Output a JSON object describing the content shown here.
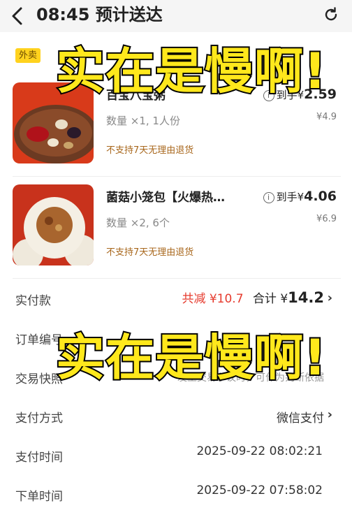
{
  "header": {
    "title": "08:45 预计送达"
  },
  "store": {
    "tag": "外卖"
  },
  "items": [
    {
      "name": "百宝八宝粥",
      "qty": "数量 ×1, 1人份",
      "final_price_label": "到手¥",
      "final_price": "2.59",
      "original_price": "¥4.9",
      "return_policy": "不支持7天无理由退货"
    },
    {
      "name": "菌菇小笼包【火爆热…",
      "qty": "数量 ×2, 6个",
      "final_price_label": "到手¥",
      "final_price": "4.06",
      "original_price": "¥6.9",
      "return_policy": "不支持7天无理由退货"
    }
  ],
  "payment": {
    "label": "实付款",
    "discount": "共减 ¥10.7",
    "total_label": "合计 ¥",
    "total": "14.2"
  },
  "order_rows": [
    {
      "label": "订单编号",
      "value": ""
    },
    {
      "label": "交易快照",
      "value": "发生交易争议时，可作为判断依据"
    },
    {
      "label": "支付方式",
      "value": "微信支付"
    },
    {
      "label": "支付时间",
      "value": "2025-09-22 08:02:21"
    },
    {
      "label": "下单时间",
      "value": "2025-09-22 07:58:02"
    }
  ],
  "overlays": [
    "实在是慢啊!",
    "实在是慢啊!"
  ],
  "colors": {
    "takeout_tag": "#ffd21e",
    "discount": "#e63b2e",
    "overlay_text": "#ffe81c",
    "return_policy": "#a8671c"
  }
}
